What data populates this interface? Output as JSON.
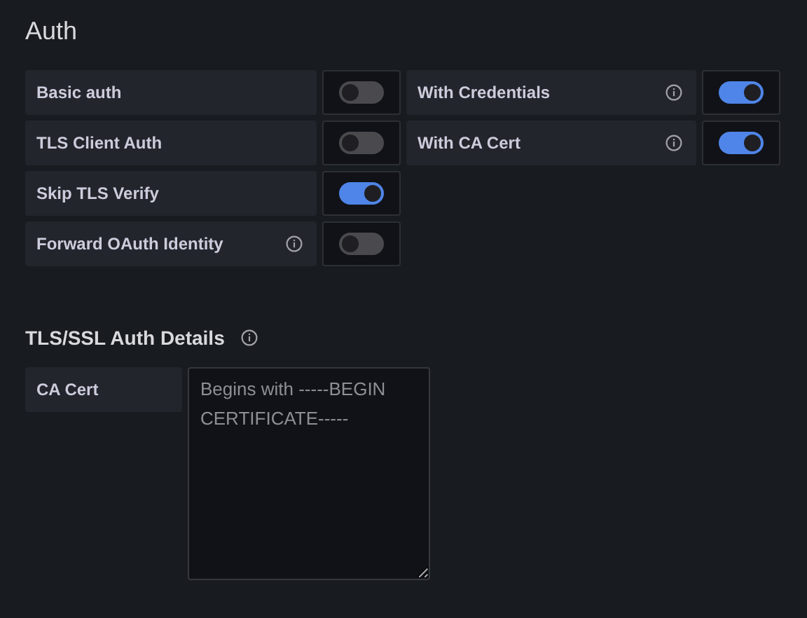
{
  "title": "Auth",
  "rows": [
    [
      {
        "label": "Basic auth",
        "info": false,
        "on": false
      },
      {
        "label": "With Credentials",
        "info": true,
        "on": true
      }
    ],
    [
      {
        "label": "TLS Client Auth",
        "info": false,
        "on": false
      },
      {
        "label": "With CA Cert",
        "info": true,
        "on": true
      }
    ],
    [
      {
        "label": "Skip TLS Verify",
        "info": false,
        "on": true
      }
    ],
    [
      {
        "label": "Forward OAuth Identity",
        "info": true,
        "on": false
      }
    ]
  ],
  "details": {
    "heading": "TLS/SSL Auth Details",
    "info": true,
    "fields": [
      {
        "label": "CA Cert",
        "placeholder": "Begins with -----BEGIN CERTIFICATE-----"
      }
    ]
  }
}
